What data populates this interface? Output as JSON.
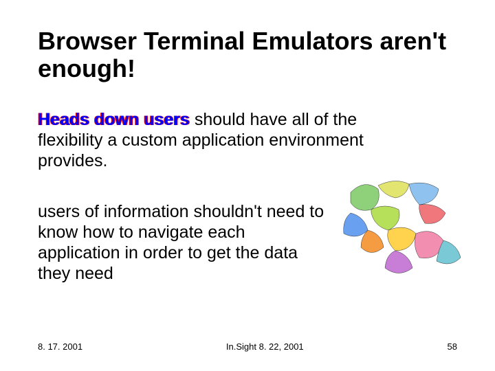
{
  "title": "Browser Terminal Emulators aren't enough!",
  "para1": {
    "emph": "Heads down users",
    "rest": " should have all of the flexibility a custom application environment provides."
  },
  "para2": "users of information shouldn't need to know how to navigate each application in order to get the data they need",
  "footer": {
    "left": "8. 17. 2001",
    "center": "In.Sight 8. 22, 2001",
    "right": "58"
  },
  "image_name": "europe-map-colored"
}
